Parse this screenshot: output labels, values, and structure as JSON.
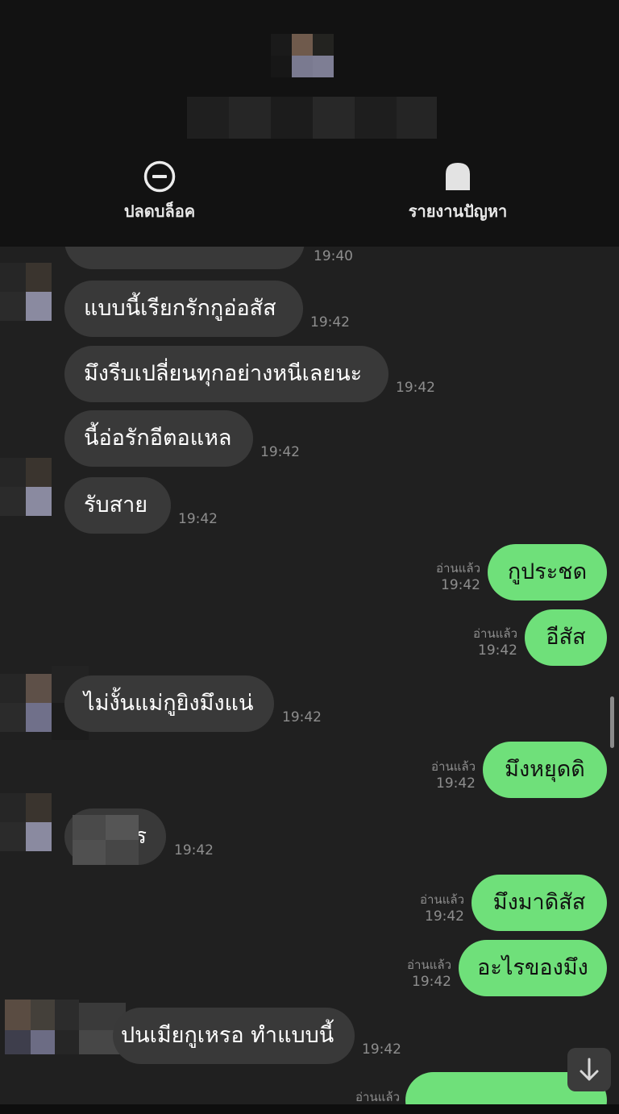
{
  "header": {
    "unblock_label": "ปลดบล็อค",
    "report_label": "รายงานปัญหา"
  },
  "colors": {
    "incoming_bubble": "#393939",
    "outgoing_bubble": "#6fe07a",
    "background": "#202020",
    "header_background": "#121212",
    "timestamp": "#8e8e8e"
  },
  "icons": {
    "unblock": "minus-circle-icon",
    "report": "tombstone-report-icon",
    "scroll_down": "arrow-down-icon"
  },
  "messages": [
    {
      "side": "in",
      "text": "",
      "time": "19:40"
    },
    {
      "side": "in",
      "text": "แบบนี้เรียกรักกูอ่อสัส",
      "time": "19:42"
    },
    {
      "side": "in",
      "text": "มึงรีบเปลี่ยนทุกอย่างหนีเลยนะ",
      "time": "19:42"
    },
    {
      "side": "in",
      "text": "นี้อ่อรักอีตอแหล",
      "time": "19:42"
    },
    {
      "side": "in",
      "text": "รับสาย",
      "time": "19:42"
    },
    {
      "side": "out",
      "text": "กูประชด",
      "read": "อ่านแล้ว",
      "time": "19:42"
    },
    {
      "side": "out",
      "text": "อีสัส",
      "read": "อ่านแล้ว",
      "time": "19:42"
    },
    {
      "side": "in",
      "text": "ไม่งั้นแม่กูยิงมึงแน่",
      "time": "19:42"
    },
    {
      "side": "out",
      "text": "มึงหยุดดิ",
      "read": "อ่านแล้ว",
      "time": "19:42"
    },
    {
      "side": "in",
      "text": "ร",
      "time": "19:42"
    },
    {
      "side": "out",
      "text": "มึงมาดิสัส",
      "read": "อ่านแล้ว",
      "time": "19:42"
    },
    {
      "side": "out",
      "text": "อะไรของมึง",
      "read": "อ่านแล้ว",
      "time": "19:42"
    },
    {
      "side": "in",
      "text": "ปนเมียกูเหรอ ทำแบบนี้",
      "time": "19:42"
    },
    {
      "side": "out",
      "text": "",
      "read": "อ่านแล้ว",
      "time": ""
    }
  ]
}
